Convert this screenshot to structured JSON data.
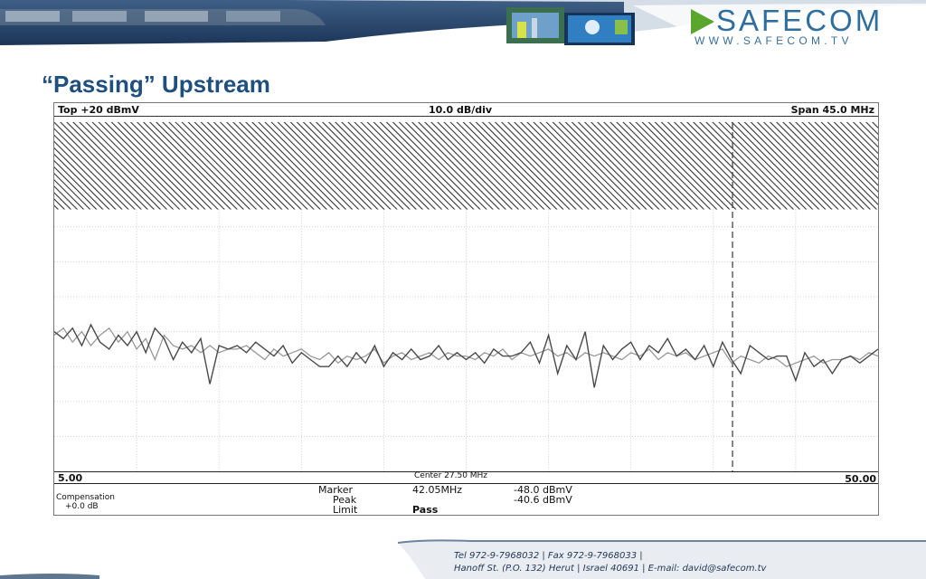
{
  "brand": {
    "name": "SAFECOM",
    "url": "WWW.SAFECOM.TV",
    "accent": "#1f4f7e",
    "logo_green": "#5aa52c"
  },
  "slide": {
    "title": "“Passing” Upstream"
  },
  "printout": {
    "top_ref": "Top +20 dBmV",
    "scale": "10.0 dB/div",
    "span": "Span 45.0 MHz",
    "start_freq": "5.00",
    "center": "Center  27.50 MHz",
    "stop_freq": "50.00",
    "marker_label": "Marker",
    "marker_freq": "42.05MHz",
    "marker_level": "-48.0 dBmV",
    "peak_label": "Peak",
    "peak_level": "-40.6 dBmV",
    "limit_label": "Limit",
    "limit_value": "Pass",
    "comp_label": "Compensation",
    "comp_value": "+0.0 dB"
  },
  "footer": {
    "line1": "Tel 972-9-7968032 | Fax 972-9-7968033 |",
    "line2": "Hanoff St. (P.O. 132) Herut  | Israel 40691 | E-mail: david@safecom.tv"
  },
  "chart_data": {
    "type": "line",
    "xlim": [
      5,
      50
    ],
    "ylim": [
      -80,
      20
    ],
    "grid": true,
    "y_divisions": 10,
    "x_divisions": 10,
    "limit_band": [
      -5,
      20
    ],
    "marker_x": 42.05,
    "series": [
      {
        "x": [
          5.0,
          5.5,
          6.0,
          6.5,
          7.0,
          7.5,
          8.0,
          8.5,
          9.0,
          9.5,
          10.0,
          10.5,
          11.0,
          11.5,
          12.0,
          12.5,
          13.0,
          13.5,
          14.0,
          14.5,
          15.0,
          15.5,
          16.0,
          16.5,
          17.0,
          17.5,
          18.0,
          18.5,
          19.0,
          19.5,
          20.0,
          20.5,
          21.0,
          21.5,
          22.0,
          22.5,
          23.0,
          23.5,
          24.0,
          24.5,
          25.0,
          25.5,
          26.0,
          26.5,
          27.0,
          27.5,
          28.0,
          28.5,
          29.0,
          29.5,
          30.0,
          30.5,
          31.0,
          31.5,
          32.0,
          32.5,
          33.0,
          33.5,
          34.0,
          34.5,
          35.0,
          35.5,
          36.0,
          36.5,
          37.0,
          37.5,
          38.0,
          38.5,
          39.0,
          39.5,
          40.0,
          40.5,
          41.0,
          41.5,
          42.0,
          42.5,
          43.0,
          43.5,
          44.0,
          44.5,
          45.0,
          45.5,
          46.0,
          46.5,
          47.0,
          47.5,
          48.0,
          48.5,
          49.0,
          49.5,
          50.0
        ],
        "values": [
          -40,
          -42,
          -39,
          -44,
          -38,
          -43,
          -45,
          -41,
          -44,
          -40,
          -46,
          -39,
          -42,
          -48,
          -43,
          -46,
          -42,
          -55,
          -44,
          -45,
          -44,
          -46,
          -43,
          -45,
          -47,
          -44,
          -49,
          -46,
          -48,
          -50,
          -50,
          -47,
          -50,
          -46,
          -49,
          -44,
          -50,
          -46,
          -48,
          -45,
          -48,
          -47,
          -44,
          -48,
          -46,
          -48,
          -46,
          -49,
          -45,
          -47,
          -47,
          -46,
          -43,
          -49,
          -41,
          -52,
          -44,
          -48,
          -40,
          -56,
          -44,
          -48,
          -45,
          -43,
          -48,
          -44,
          -46,
          -42,
          -47,
          -45,
          -48,
          -44,
          -50,
          -43,
          -48,
          -52,
          -44,
          -46,
          -48,
          -47,
          -47,
          -54,
          -46,
          -50,
          -48,
          -52,
          -48,
          -47,
          -49,
          -47,
          -45
        ]
      },
      {
        "x": [
          5.0,
          5.5,
          6.0,
          6.5,
          7.0,
          7.5,
          8.0,
          8.5,
          9.0,
          9.5,
          10.0,
          10.5,
          11.0,
          11.5,
          12.0,
          12.5,
          13.0,
          13.5,
          14.0,
          14.5,
          15.0,
          15.5,
          16.0,
          16.5,
          17.0,
          17.5,
          18.0,
          18.5,
          19.0,
          19.5,
          20.0,
          20.5,
          21.0,
          21.5,
          22.0,
          22.5,
          23.0,
          23.5,
          24.0,
          24.5,
          25.0,
          25.5,
          26.0,
          26.5,
          27.0,
          27.5,
          28.0,
          28.5,
          29.0,
          29.5,
          30.0,
          30.5,
          31.0,
          31.5,
          32.0,
          32.5,
          33.0,
          33.5,
          34.0,
          34.5,
          35.0,
          35.5,
          36.0,
          36.5,
          37.0,
          37.5,
          38.0,
          38.5,
          39.0,
          39.5,
          40.0,
          40.5,
          41.0,
          41.5,
          42.0,
          42.5,
          43.0,
          43.5,
          44.0,
          44.5,
          45.0,
          45.5,
          46.0,
          46.5,
          47.0,
          47.5,
          48.0,
          48.5,
          49.0,
          49.5,
          50.0
        ],
        "values": [
          -41,
          -39,
          -43,
          -40,
          -44,
          -41,
          -39,
          -43,
          -40,
          -45,
          -42,
          -48,
          -41,
          -44,
          -45,
          -44,
          -46,
          -44,
          -46,
          -45,
          -45,
          -44,
          -46,
          -48,
          -45,
          -47,
          -46,
          -45,
          -47,
          -48,
          -46,
          -49,
          -47,
          -48,
          -47,
          -45,
          -49,
          -47,
          -46,
          -48,
          -47,
          -46,
          -48,
          -46,
          -47,
          -47,
          -48,
          -46,
          -47,
          -45,
          -48,
          -46,
          -47,
          -46,
          -45,
          -47,
          -46,
          -48,
          -46,
          -47,
          -46,
          -47,
          -48,
          -46,
          -47,
          -45,
          -48,
          -46,
          -47,
          -46,
          -48,
          -47,
          -46,
          -45,
          -49,
          -47,
          -48,
          -49,
          -47,
          -48,
          -50,
          -49,
          -48,
          -47,
          -49,
          -48,
          -48,
          -47,
          -48,
          -46,
          -47
        ]
      }
    ]
  }
}
